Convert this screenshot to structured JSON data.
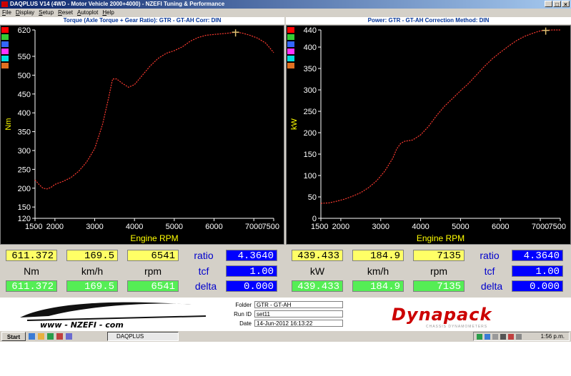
{
  "window": {
    "title": "DAQPLUS V14 (4WD - Motor Vehicle 2000+4000) - NZEFI Tuning & Performance",
    "buttons": [
      "_",
      "□",
      "×"
    ]
  },
  "menu": [
    "File",
    "Display",
    "Setup",
    "Reset",
    "Autoplot",
    "Help"
  ],
  "colors": {
    "curve": "#ff3b30",
    "axis": "#ffffff",
    "label": "#ffff00",
    "accent": "#003399"
  },
  "swatch_colors": [
    "#ff0000",
    "#33cc33",
    "#3366ff",
    "#ff33ff",
    "#00e0e0",
    "#e07020"
  ],
  "torque_panel": {
    "title": "Torque (Axle Torque + Gear Ratio): GTR - GT-AH     Corr: DIN"
  },
  "power_panel": {
    "title": "Power: GTR - GT-AH     Correction Method: DIN"
  },
  "chart_data": [
    {
      "type": "line",
      "xlabel": "Engine RPM",
      "ylabel": "Nm",
      "xlim": [
        1500,
        7500
      ],
      "ylim": [
        120,
        620
      ],
      "xticks": [
        "1500",
        "2000",
        "3000",
        "4000",
        "5000",
        "6000",
        "7000",
        "7500"
      ],
      "xtick_values": [
        1500,
        2000,
        3000,
        4000,
        5000,
        6000,
        7000,
        7500
      ],
      "yticks": [
        "120",
        "150",
        "200",
        "250",
        "300",
        "350",
        "400",
        "450",
        "500",
        "550",
        "620"
      ],
      "ytick_values": [
        120,
        150,
        200,
        250,
        300,
        350,
        400,
        450,
        500,
        550,
        620
      ],
      "series": [
        {
          "x": [
            1500,
            1600,
            1700,
            1800,
            1900,
            2000,
            2200,
            2400,
            2600,
            2800,
            3000,
            3200,
            3350,
            3450,
            3550,
            3700,
            3850,
            4000,
            4200,
            4400,
            4600,
            4800,
            5000,
            5200,
            5400,
            5600,
            5800,
            6000,
            6200,
            6400,
            6541,
            6700,
            6900,
            7100,
            7300,
            7500
          ],
          "y": [
            222,
            210,
            200,
            198,
            202,
            210,
            218,
            228,
            245,
            270,
            305,
            370,
            440,
            490,
            490,
            478,
            468,
            475,
            500,
            525,
            545,
            558,
            565,
            575,
            590,
            600,
            606,
            608,
            610,
            612,
            614,
            612,
            606,
            598,
            585,
            560
          ]
        }
      ],
      "cursor": {
        "x": 6541,
        "y": 614
      }
    },
    {
      "type": "line",
      "xlabel": "Engine RPM",
      "ylabel": "kW",
      "xlim": [
        1500,
        7500
      ],
      "ylim": [
        0,
        440
      ],
      "xticks": [
        "1500",
        "2000",
        "3000",
        "4000",
        "5000",
        "6000",
        "7000",
        "7500"
      ],
      "xtick_values": [
        1500,
        2000,
        3000,
        4000,
        5000,
        6000,
        7000,
        7500
      ],
      "yticks": [
        "0",
        "50",
        "100",
        "150",
        "200",
        "250",
        "300",
        "350",
        "400",
        "440"
      ],
      "ytick_values": [
        0,
        50,
        100,
        150,
        200,
        250,
        300,
        350,
        400,
        440
      ],
      "series": [
        {
          "x": [
            1500,
            1700,
            1900,
            2100,
            2300,
            2500,
            2700,
            2900,
            3100,
            3300,
            3400,
            3500,
            3600,
            3800,
            4000,
            4200,
            4400,
            4600,
            4800,
            5000,
            5200,
            5400,
            5600,
            5800,
            6000,
            6200,
            6400,
            6600,
            6800,
            7000,
            7135,
            7300,
            7500
          ],
          "y": [
            35,
            36,
            40,
            45,
            52,
            60,
            72,
            88,
            110,
            140,
            162,
            175,
            180,
            183,
            195,
            215,
            240,
            262,
            280,
            298,
            315,
            335,
            355,
            373,
            388,
            402,
            415,
            425,
            432,
            438,
            439,
            440,
            440
          ]
        }
      ],
      "cursor": {
        "x": 7135,
        "y": 439
      }
    }
  ],
  "left_readouts": {
    "torque_top": "611.372",
    "speed_top": "169.5",
    "rpm_top": "6541",
    "unit_torque": "Nm",
    "unit_speed": "km/h",
    "unit_rpm": "rpm",
    "torque_bottom": "611.372",
    "speed_bottom": "169.5",
    "rpm_bottom": "6541",
    "ratio_label": "ratio",
    "ratio_value": "4.3640",
    "tcf_label": "tcf",
    "tcf_value": "1.00",
    "delta_label": "delta",
    "delta_value": "0.000"
  },
  "right_readouts": {
    "power_top": "439.433",
    "speed_top": "184.9",
    "rpm_top": "7135",
    "unit_power": "kW",
    "unit_speed": "km/h",
    "unit_rpm": "rpm",
    "power_bottom": "439.433",
    "speed_bottom": "184.9",
    "rpm_bottom": "7135",
    "ratio_label": "ratio",
    "ratio_value": "4.3640",
    "tcf_label": "tcf",
    "tcf_value": "1.00",
    "delta_label": "delta",
    "delta_value": "0.000"
  },
  "info": {
    "folder_label": "Folder",
    "folder_value": "GTR - GT-AH",
    "run_label": "Run ID",
    "run_value": "set11",
    "date_label": "Date",
    "date_value": "14-Jun-2012 16:13:22"
  },
  "branding": {
    "left_logo": "www - NZEFI - com",
    "right_logo": "Dynapack",
    "right_sub": "CHASSIS DYNAMOMETERS"
  },
  "taskbar": {
    "start": "Start",
    "task": "DAQPLUS",
    "clock": "1:56 p.m."
  }
}
